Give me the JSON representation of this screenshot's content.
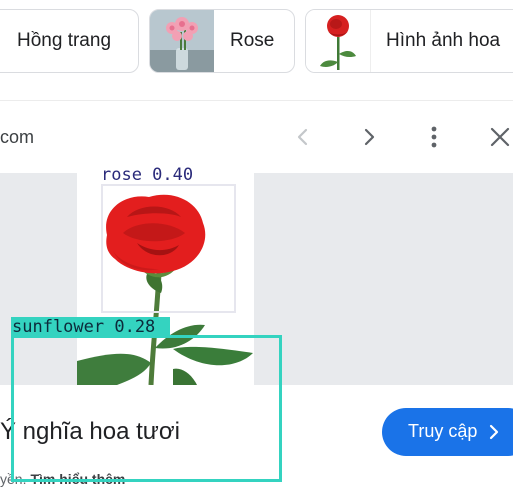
{
  "related_searches": [
    {
      "label": "Hồng trang",
      "has_thumbnail": false
    },
    {
      "label": "Rose",
      "has_thumbnail": true
    },
    {
      "label": "Hình ảnh hoa",
      "has_thumbnail": true
    }
  ],
  "viewer": {
    "source_domain": "com",
    "toolbar": {
      "prev_icon": "chevron-left-icon",
      "next_icon": "chevron-right-icon",
      "more_icon": "more-vert-icon",
      "close_icon": "close-icon"
    },
    "title": "Ý nghĩa hoa tươi",
    "visit_button": {
      "label": "Truy cập"
    },
    "copyright_prefix": "yền.",
    "learn_more": "Tìm hiểu thêm"
  },
  "detections": [
    {
      "label": "rose 0.40",
      "color": "#e6e6ee",
      "text_color": "#2a2a7a"
    },
    {
      "label": "sunflower 0.28",
      "color": "#34d3c0",
      "text_color": "#0c2b3b"
    }
  ],
  "colors": {
    "accent": "#1a73e8",
    "image_background": "#e8eaed",
    "rose_red": "#e02020",
    "leaf_green": "#3a7d3a"
  }
}
